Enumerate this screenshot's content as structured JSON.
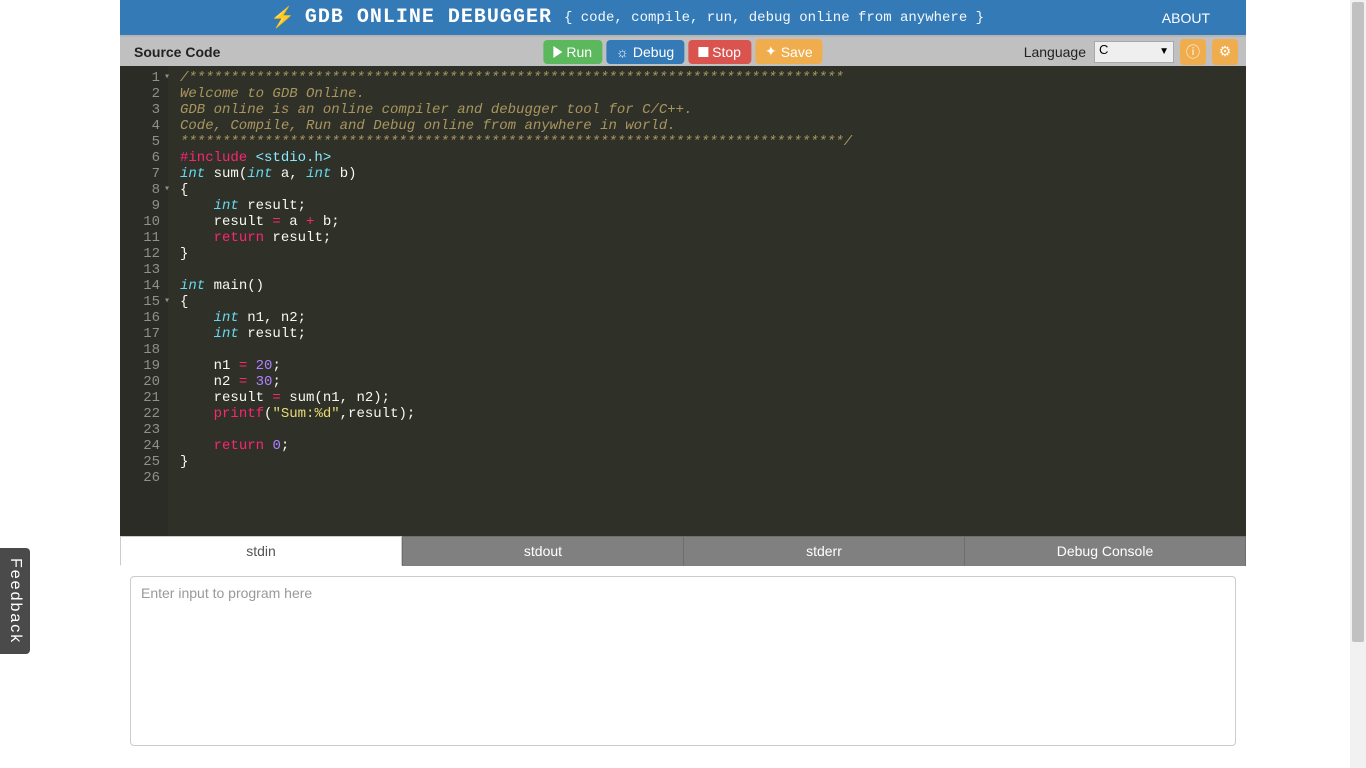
{
  "header": {
    "brand": "GDB ONLINE DEBUGGER",
    "tagline": "{ code, compile, run, debug online from anywhere }",
    "about": "ABOUT"
  },
  "toolbar": {
    "source_label": "Source Code",
    "run": "Run",
    "debug": "Debug",
    "stop": "Stop",
    "save": "Save",
    "language_label": "Language",
    "language_value": "C"
  },
  "code": {
    "lines": [
      "/******************************************************************************",
      "Welcome to GDB Online.",
      "GDB online is an online compiler and debugger tool for C/C++.",
      "Code, Compile, Run and Debug online from anywhere in world.",
      "*******************************************************************************/",
      "#include <stdio.h>",
      "int sum(int a, int b)",
      "{",
      "    int result;",
      "    result = a + b;",
      "    return result;",
      "}",
      "",
      "int main()",
      "{",
      "    int n1, n2;",
      "    int result;",
      "",
      "    n1 = 20;",
      "    n2 = 30;",
      "    result = sum(n1, n2);",
      "    printf(\"Sum:%d\",result);",
      "",
      "    return 0;",
      "}",
      ""
    ]
  },
  "io": {
    "tabs": [
      "stdin",
      "stdout",
      "stderr",
      "Debug Console"
    ],
    "active_tab": 0,
    "stdin_placeholder": "Enter input to program here"
  },
  "feedback_label": "Feedback"
}
